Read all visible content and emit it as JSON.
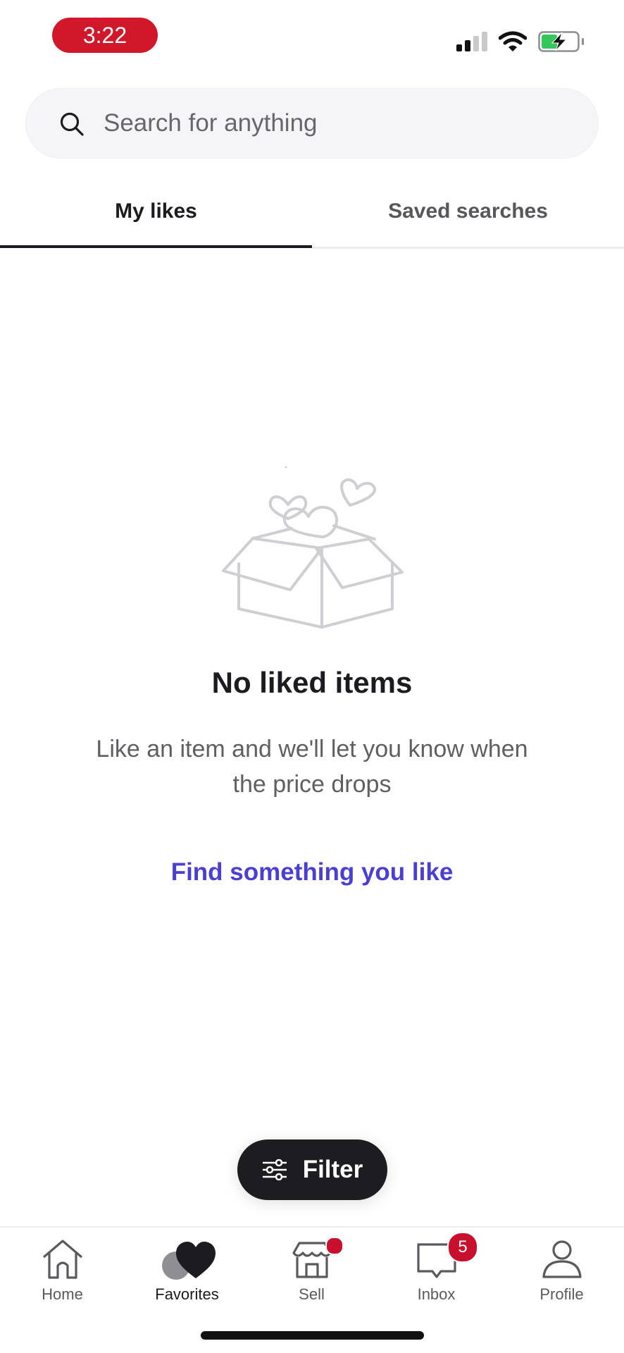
{
  "status_bar": {
    "time": "3:22",
    "signal_bars_active": 2,
    "signal_bars_total": 4,
    "battery_level": 0.4,
    "battery_charging": true
  },
  "search": {
    "placeholder": "Search for anything",
    "value": "",
    "icon": "search-icon"
  },
  "tabs": [
    {
      "label": "My likes",
      "active": true
    },
    {
      "label": "Saved searches",
      "active": false
    }
  ],
  "empty_state": {
    "illustration": "open-box-with-hearts",
    "title": "No liked items",
    "body": "Like an item and we'll let you know when the price drops",
    "link_label": "Find something you like"
  },
  "filter_button": {
    "label": "Filter",
    "icon": "sliders-icon"
  },
  "bottom_nav": {
    "items": [
      {
        "label": "Home",
        "icon": "home-icon",
        "active": false
      },
      {
        "label": "Favorites",
        "icon": "heart-icon",
        "active": true
      },
      {
        "label": "Sell",
        "icon": "storefront-icon",
        "active": false,
        "dot": true
      },
      {
        "label": "Inbox",
        "icon": "chat-bubble-icon",
        "active": false,
        "badge": "5"
      },
      {
        "label": "Profile",
        "icon": "person-icon",
        "active": false
      }
    ]
  },
  "colors": {
    "accent_link": "#4b3fd2",
    "badge": "#c8102e",
    "time_pill": "#d0182a",
    "primary_dark": "#1d1c20"
  }
}
